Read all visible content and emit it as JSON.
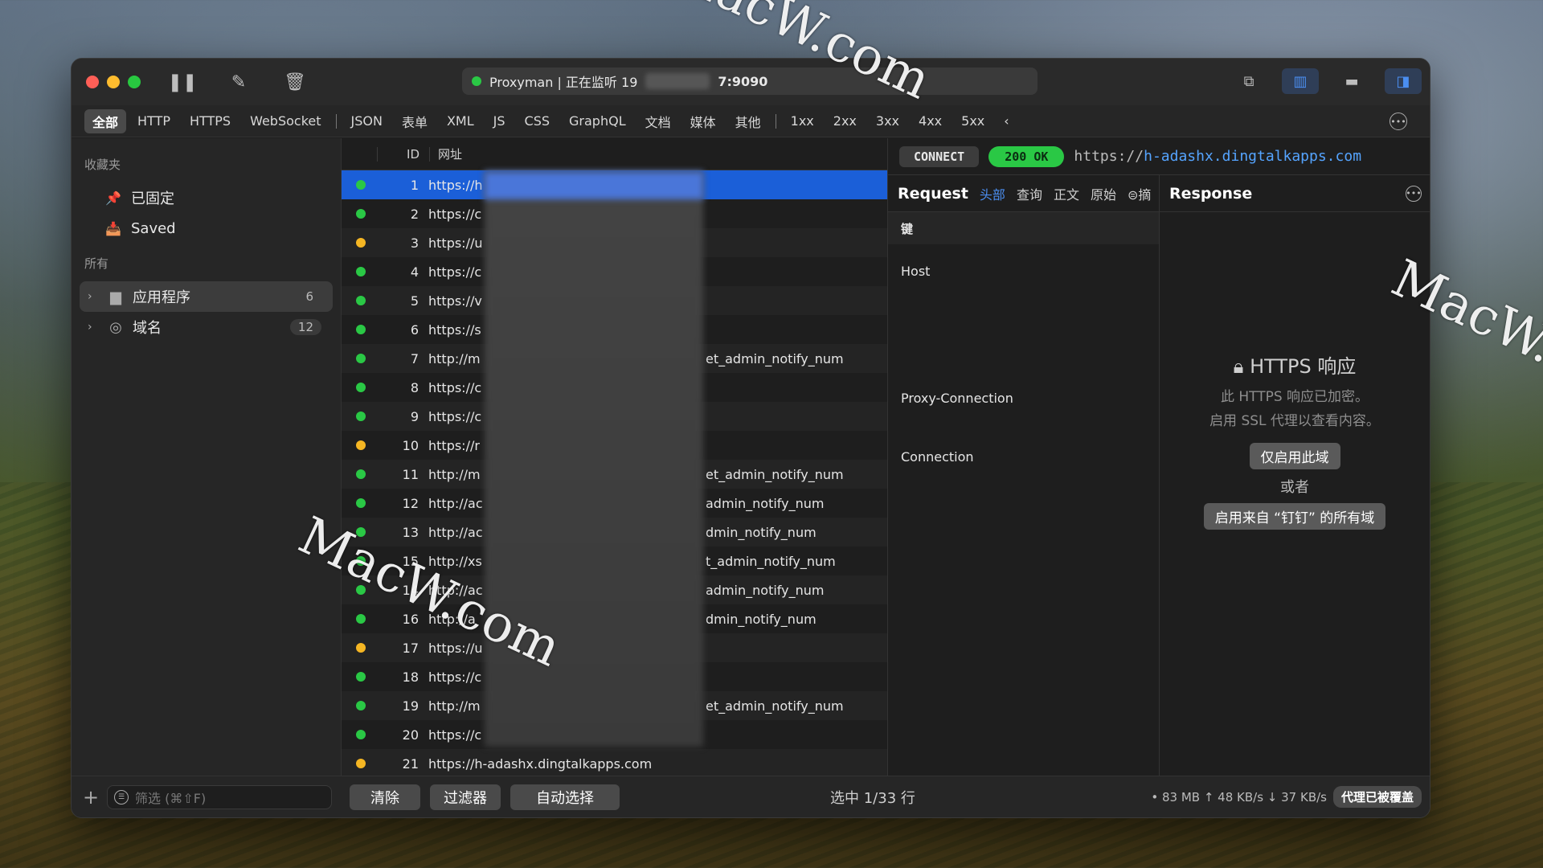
{
  "window": {
    "status_prefix": "Proxyman | 正在监听 19",
    "status_suffix": "7:9090"
  },
  "filters": [
    "全部",
    "HTTP",
    "HTTPS",
    "WebSocket",
    "JSON",
    "表单",
    "XML",
    "JS",
    "CSS",
    "GraphQL",
    "文档",
    "媒体",
    "其他",
    "1xx",
    "2xx",
    "3xx",
    "4xx",
    "5xx"
  ],
  "sidebar": {
    "favorites_header": "收藏夹",
    "pinned": "已固定",
    "saved": "Saved",
    "all_header": "所有",
    "apps_label": "应用程序",
    "apps_count": "6",
    "domains_label": "域名",
    "domains_count": "12"
  },
  "list": {
    "col_id": "ID",
    "col_url": "网址",
    "rows": [
      {
        "id": "1",
        "url": "https://h",
        "tail": "",
        "status": "green"
      },
      {
        "id": "2",
        "url": "https://c",
        "tail": "",
        "status": "green"
      },
      {
        "id": "3",
        "url": "https://u",
        "tail": "",
        "status": "yellow"
      },
      {
        "id": "4",
        "url": "https://c",
        "tail": "",
        "status": "green"
      },
      {
        "id": "5",
        "url": "https://v",
        "tail": "",
        "status": "green"
      },
      {
        "id": "6",
        "url": "https://s",
        "tail": "",
        "status": "green"
      },
      {
        "id": "7",
        "url": "http://m",
        "tail": "et_admin_notify_num",
        "status": "green"
      },
      {
        "id": "8",
        "url": "https://c",
        "tail": "",
        "status": "green"
      },
      {
        "id": "9",
        "url": "https://c",
        "tail": "",
        "status": "green"
      },
      {
        "id": "10",
        "url": "https://r",
        "tail": "",
        "status": "yellow"
      },
      {
        "id": "11",
        "url": "http://m",
        "tail": "et_admin_notify_num",
        "status": "green"
      },
      {
        "id": "12",
        "url": "http://ac",
        "tail": "admin_notify_num",
        "status": "green"
      },
      {
        "id": "13",
        "url": "http://ac",
        "tail": "dmin_notify_num",
        "status": "green"
      },
      {
        "id": "15",
        "url": "http://xs",
        "tail": "t_admin_notify_num",
        "status": "green"
      },
      {
        "id": "14",
        "url": "http://ac",
        "tail": "admin_notify_num",
        "status": "green"
      },
      {
        "id": "16",
        "url": "http://a",
        "tail": "dmin_notify_num",
        "status": "green"
      },
      {
        "id": "17",
        "url": "https://u",
        "tail": "",
        "status": "yellow"
      },
      {
        "id": "18",
        "url": "https://c",
        "tail": "",
        "status": "green"
      },
      {
        "id": "19",
        "url": "http://m",
        "tail": "et_admin_notify_num",
        "status": "green"
      },
      {
        "id": "20",
        "url": "https://c",
        "tail": "",
        "status": "green"
      },
      {
        "id": "21",
        "url": "https://h-adashx.dingtalkapps.com",
        "tail": "",
        "status": "yellow"
      }
    ]
  },
  "detail": {
    "method": "CONNECT",
    "status": "200 OK",
    "url_scheme": "https://",
    "url_host": "h-adashx.dingtalkapps.com",
    "request_title": "Request",
    "request_tabs": [
      "头部",
      "查询",
      "正文",
      "原始",
      "摘"
    ],
    "key_header": "键",
    "keys": [
      "Host",
      "Proxy-Connection",
      "Connection"
    ],
    "response_title": "Response",
    "https_title": "HTTPS 响应",
    "https_desc1": "此 HTTPS 响应已加密。",
    "https_desc2": "启用 SSL 代理以查看内容。",
    "enable_domain_btn": "仅启用此域",
    "or_text": "或者",
    "enable_all_btn": "启用来自 “钉钉” 的所有域"
  },
  "bottom": {
    "filter_placeholder": "筛选 (⌘⇧F)",
    "clear_btn": "清除",
    "filter_btn": "过滤器",
    "auto_select_btn": "自动选择",
    "selection": "选中 1/33 行",
    "stats": "• 83 MB ↑ 48 KB/s ↓ 37 KB/s",
    "proxy_badge": "代理已被覆盖"
  },
  "watermark": "MacW.com",
  "colors": {
    "green": "#2ac845",
    "yellow": "#f5b623",
    "accent": "#1b5fd8",
    "link": "#55a4ff"
  }
}
